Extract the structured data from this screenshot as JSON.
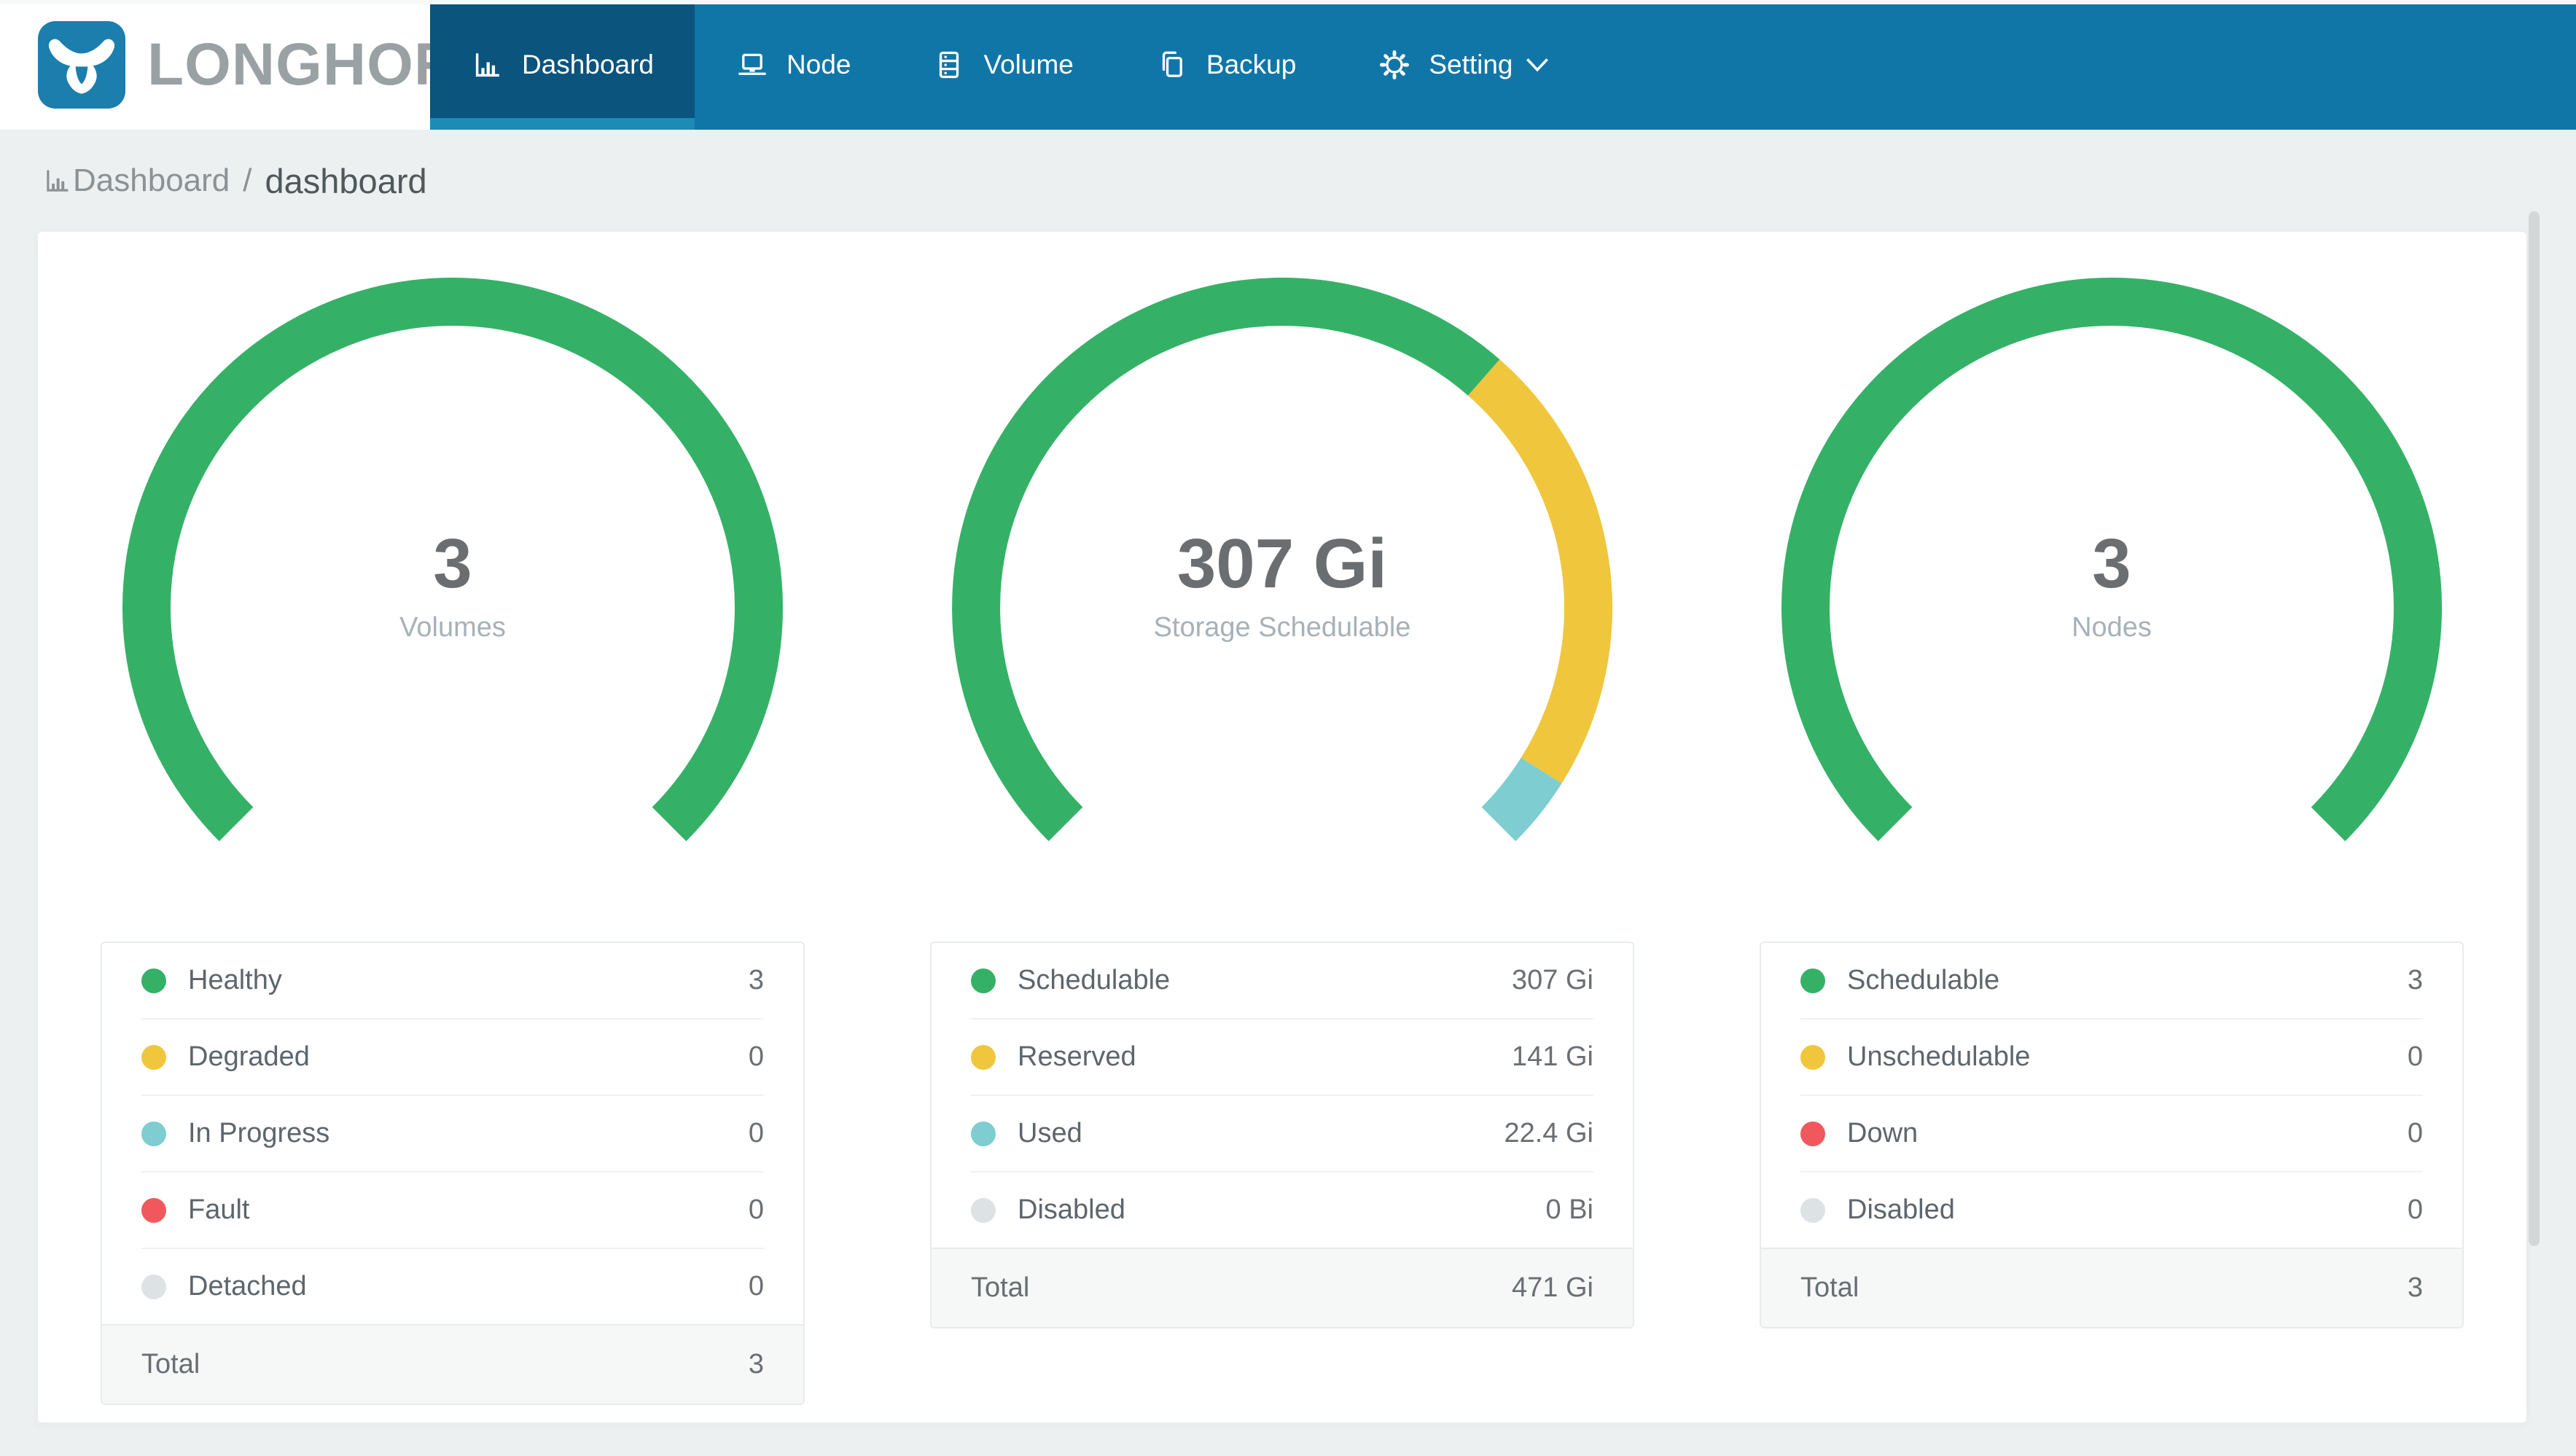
{
  "nav": {
    "brand": "LONGHORN",
    "items": [
      {
        "label": "Dashboard",
        "icon": "bar-chart-icon",
        "active": true,
        "has_dropdown": false
      },
      {
        "label": "Node",
        "icon": "laptop-icon",
        "active": false,
        "has_dropdown": false
      },
      {
        "label": "Volume",
        "icon": "server-cabinet-icon",
        "active": false,
        "has_dropdown": false
      },
      {
        "label": "Backup",
        "icon": "copy-icon",
        "active": false,
        "has_dropdown": false
      },
      {
        "label": "Setting",
        "icon": "gear-icon",
        "active": false,
        "has_dropdown": true
      }
    ]
  },
  "breadcrumb": {
    "icon": "bar-chart-icon",
    "section": "Dashboard",
    "separator": "/",
    "page": "dashboard"
  },
  "colors": {
    "navbar-bg": "#1076a7",
    "active-tab-bg": "#0a547e",
    "active-tab-underline": "#1c8cb5",
    "page-bg": "#edf0f0",
    "brand-blue": "#1b7eac",
    "status-green": "#35b167",
    "status-yellow": "#f0c63d",
    "status-teal": "#7dcdd1",
    "status-red": "#f0585d",
    "status-gray": "#dde2e5"
  },
  "chart_data": [
    {
      "type": "gauge",
      "title": "Volumes",
      "center_value": "3",
      "center_label": "Volumes",
      "arc": {
        "start_deg": 135,
        "sweep_deg": 270,
        "radius": 420,
        "stroke_width": 66
      },
      "segments": [
        {
          "name": "Healthy",
          "value": 3,
          "display": "3",
          "color": "#35b167"
        },
        {
          "name": "Degraded",
          "value": 0,
          "display": "0",
          "color": "#f0c63d"
        },
        {
          "name": "In Progress",
          "value": 0,
          "display": "0",
          "color": "#7dcdd1"
        },
        {
          "name": "Fault",
          "value": 0,
          "display": "0",
          "color": "#f0585d"
        },
        {
          "name": "Detached",
          "value": 0,
          "display": "0",
          "color": "#dde2e5"
        }
      ],
      "total_label": "Total",
      "total_display": "3"
    },
    {
      "type": "gauge",
      "title": "Storage Schedulable",
      "center_value": "307 Gi",
      "center_label": "Storage Schedulable",
      "arc": {
        "start_deg": 135,
        "sweep_deg": 270,
        "radius": 420,
        "stroke_width": 66
      },
      "segments": [
        {
          "name": "Schedulable",
          "value": 307,
          "display": "307 Gi",
          "color": "#35b167"
        },
        {
          "name": "Reserved",
          "value": 141,
          "display": "141 Gi",
          "color": "#f0c63d"
        },
        {
          "name": "Used",
          "value": 22.4,
          "display": "22.4 Gi",
          "color": "#7dcdd1"
        },
        {
          "name": "Disabled",
          "value": 0,
          "display": "0 Bi",
          "color": "#dde2e5"
        }
      ],
      "total_label": "Total",
      "total_display": "471 Gi"
    },
    {
      "type": "gauge",
      "title": "Nodes",
      "center_value": "3",
      "center_label": "Nodes",
      "arc": {
        "start_deg": 135,
        "sweep_deg": 270,
        "radius": 420,
        "stroke_width": 66
      },
      "segments": [
        {
          "name": "Schedulable",
          "value": 3,
          "display": "3",
          "color": "#35b167"
        },
        {
          "name": "Unschedulable",
          "value": 0,
          "display": "0",
          "color": "#f0c63d"
        },
        {
          "name": "Down",
          "value": 0,
          "display": "0",
          "color": "#f0585d"
        },
        {
          "name": "Disabled",
          "value": 0,
          "display": "0",
          "color": "#dde2e5"
        }
      ],
      "total_label": "Total",
      "total_display": "3"
    }
  ]
}
